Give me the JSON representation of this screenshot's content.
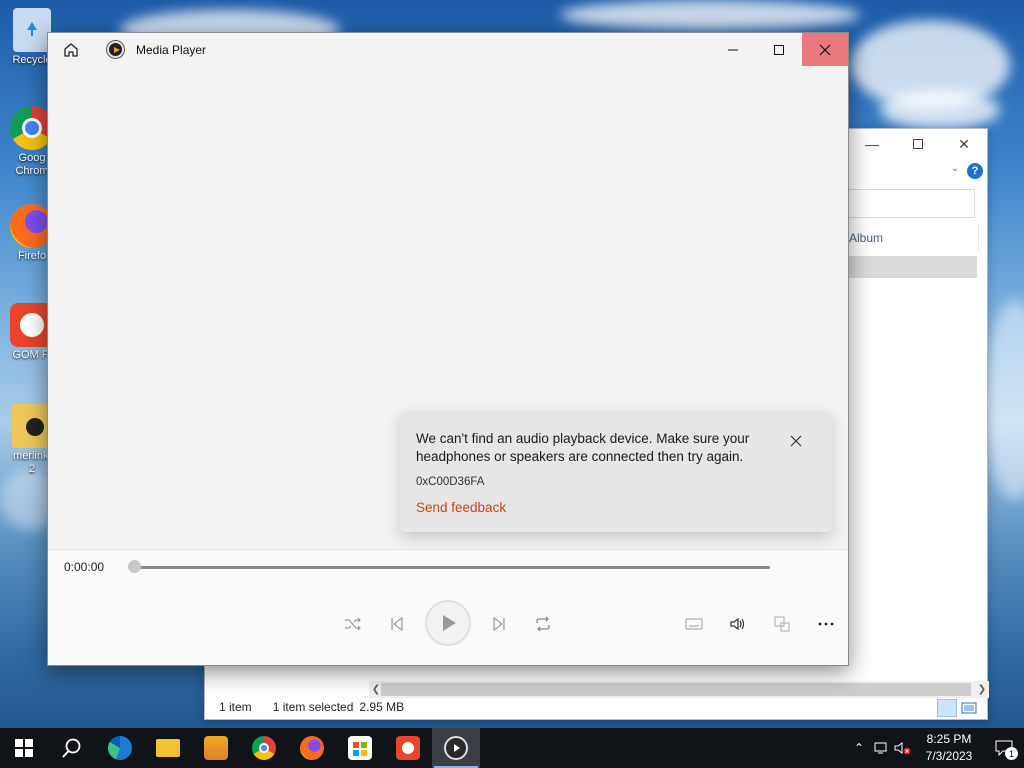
{
  "desktop": {
    "icons": [
      {
        "label": "Recycle"
      },
      {
        "label": "Goog"
      },
      {
        "label": "Chrom"
      },
      {
        "label": "Firefo"
      },
      {
        "label": "GOM Pl"
      },
      {
        "label": "merlinki"
      },
      {
        "label": "2"
      }
    ]
  },
  "explorer": {
    "column_header": "Album",
    "status": {
      "item_count": "1 item",
      "selected": "1 item selected",
      "size": "2.95 MB"
    }
  },
  "media_player": {
    "title": "Media Player",
    "toast": {
      "message": "We can't find an audio playback device. Make sure your headphones or speakers are connected then try again.",
      "code": "0xC00D36FA",
      "feedback_link": "Send feedback"
    },
    "time": "0:00:00",
    "accent": "#c44516",
    "close_hover_color": "#e9797f"
  },
  "taskbar": {
    "apps": [
      "start-icon",
      "search-icon",
      "edge-icon",
      "file-explorer-icon",
      "video-editor-icon",
      "chrome-icon",
      "firefox-icon",
      "store-icon",
      "gom-player-icon",
      "media-player-icon"
    ],
    "clock": {
      "time": "8:25 PM",
      "date": "7/3/2023"
    },
    "notification_count": "1"
  }
}
